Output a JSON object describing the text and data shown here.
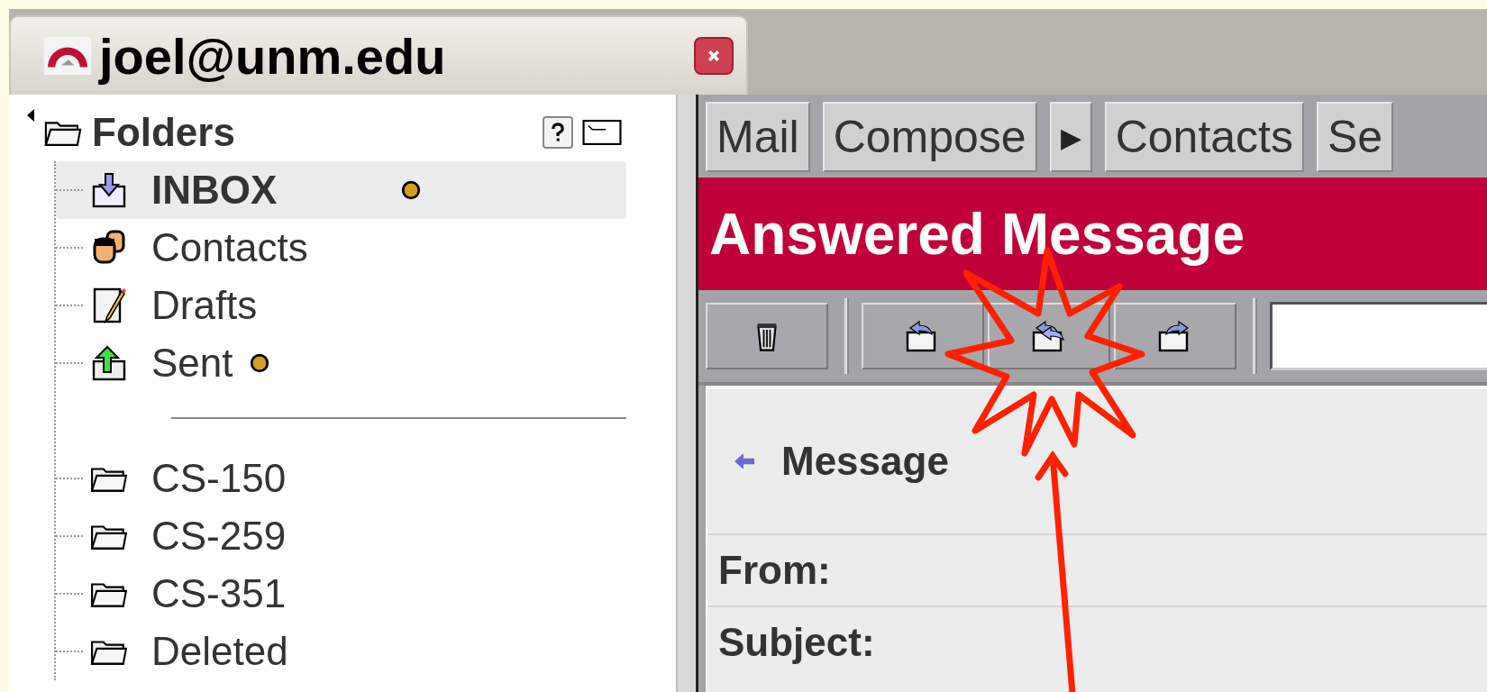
{
  "account_tab": {
    "label": "joel@unm.edu"
  },
  "sidebar": {
    "title": "Folders",
    "items": [
      {
        "kind": "inbox",
        "label": "INBOX",
        "selected": true,
        "unread_dot": true
      },
      {
        "kind": "contacts",
        "label": "Contacts",
        "selected": false,
        "unread_dot": false
      },
      {
        "kind": "drafts",
        "label": "Drafts",
        "selected": false,
        "unread_dot": false
      },
      {
        "kind": "sent",
        "label": "Sent",
        "selected": false,
        "unread_dot": true
      },
      {
        "kind": "separator"
      },
      {
        "kind": "folder",
        "label": "CS-150",
        "selected": false,
        "unread_dot": false
      },
      {
        "kind": "folder",
        "label": "CS-259",
        "selected": false,
        "unread_dot": false
      },
      {
        "kind": "folder",
        "label": "CS-351",
        "selected": false,
        "unread_dot": false
      },
      {
        "kind": "folder",
        "label": "Deleted",
        "selected": false,
        "unread_dot": false
      }
    ]
  },
  "nav": [
    "Mail",
    "Compose",
    "▶",
    "Contacts",
    "Se"
  ],
  "header": {
    "title": "Answered Message"
  },
  "toolbar": [
    {
      "kind": "delete"
    },
    {
      "kind": "reply"
    },
    {
      "kind": "reply_all"
    },
    {
      "kind": "forward"
    }
  ],
  "message": {
    "title": "Message",
    "fields": [
      "From:",
      "Subject:"
    ]
  }
}
